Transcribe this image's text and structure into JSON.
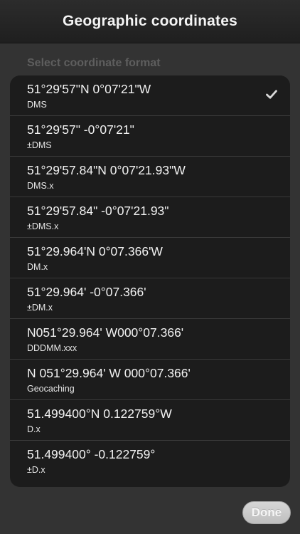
{
  "header": {
    "title": "Geographic coordinates"
  },
  "section": {
    "label": "Select coordinate format"
  },
  "formats": [
    {
      "coord": "51°29'57\"N 0°07'21\"W",
      "name": "DMS",
      "selected": true
    },
    {
      "coord": "51°29'57\" -0°07'21\"",
      "name": "±DMS",
      "selected": false
    },
    {
      "coord": "51°29'57.84\"N 0°07'21.93\"W",
      "name": "DMS.x",
      "selected": false
    },
    {
      "coord": "51°29'57.84\" -0°07'21.93\"",
      "name": "±DMS.x",
      "selected": false
    },
    {
      "coord": "51°29.964'N 0°07.366'W",
      "name": "DM.x",
      "selected": false
    },
    {
      "coord": "51°29.964' -0°07.366'",
      "name": "±DM.x",
      "selected": false
    },
    {
      "coord": "N051°29.964' W000°07.366'",
      "name": "DDDMM.xxx",
      "selected": false
    },
    {
      "coord": "N 051°29.964' W 000°07.366'",
      "name": "Geocaching",
      "selected": false
    },
    {
      "coord": "51.499400°N 0.122759°W",
      "name": "D.x",
      "selected": false
    },
    {
      "coord": "51.499400° -0.122759°",
      "name": "±D.x",
      "selected": false
    }
  ],
  "footer": {
    "done_label": "Done"
  },
  "colors": {
    "background": "#333333",
    "list_background": "#1c1c1c",
    "checkmark": "#d9d9d9"
  },
  "icons": {
    "selected": "checkmark-icon"
  }
}
